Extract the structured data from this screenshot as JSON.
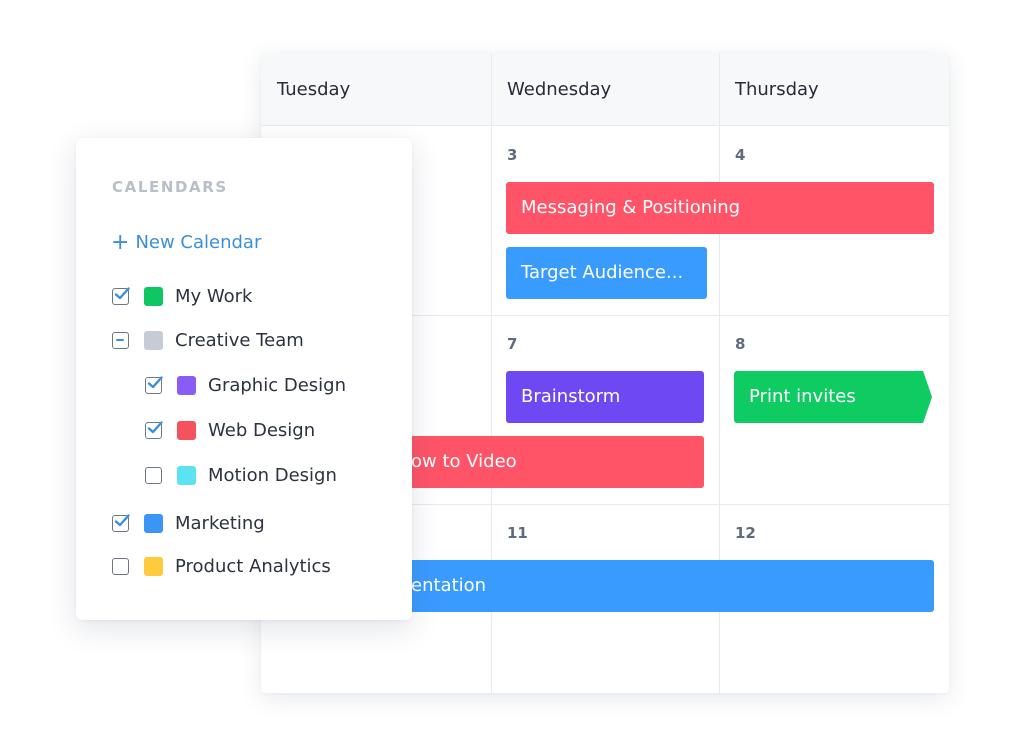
{
  "calendar": {
    "days": [
      {
        "name": "Tuesday"
      },
      {
        "name": "Wednesday"
      },
      {
        "name": "Thursday"
      }
    ],
    "weeks": [
      {
        "dates": [
          "",
          "3",
          "4"
        ]
      },
      {
        "dates": [
          "",
          "7",
          "8"
        ]
      },
      {
        "dates": [
          "",
          "11",
          "12"
        ]
      }
    ],
    "events": [
      {
        "title": "Messaging & Positioning",
        "calendar": "Web Design",
        "color": "#ff5468"
      },
      {
        "title": "Target Audience...",
        "calendar": "Marketing",
        "color": "#3a9bff"
      },
      {
        "title": "Brainstorm",
        "calendar": "Graphic Design",
        "color": "#6e48f2"
      },
      {
        "title": "Print invites",
        "calendar": "My Work",
        "color": "#0fcc62"
      },
      {
        "title": "ow to Video",
        "calendar": "Web Design",
        "color": "#ff5468"
      },
      {
        "title": "entation",
        "calendar": "Marketing",
        "color": "#3a9bff"
      }
    ]
  },
  "panel": {
    "title": "CALENDARS",
    "new_calendar_icon": "plus-icon",
    "new_calendar_label": "New Calendar",
    "items": [
      {
        "label": "My Work",
        "state": "checked",
        "color": "#10c663",
        "indent": false
      },
      {
        "label": "Creative Team",
        "state": "partial",
        "color": "#c5ccd8",
        "indent": false
      },
      {
        "label": "Graphic Design",
        "state": "checked",
        "color": "#8a5cf6",
        "indent": true
      },
      {
        "label": "Web Design",
        "state": "checked",
        "color": "#f5515f",
        "indent": true
      },
      {
        "label": "Motion Design",
        "state": "unchecked",
        "color": "#5ce3f3",
        "indent": true
      },
      {
        "label": "Marketing",
        "state": "checked",
        "color": "#3a95f5",
        "indent": false
      },
      {
        "label": "Product Analytics",
        "state": "unchecked",
        "color": "#fecb3e",
        "indent": false
      }
    ]
  }
}
